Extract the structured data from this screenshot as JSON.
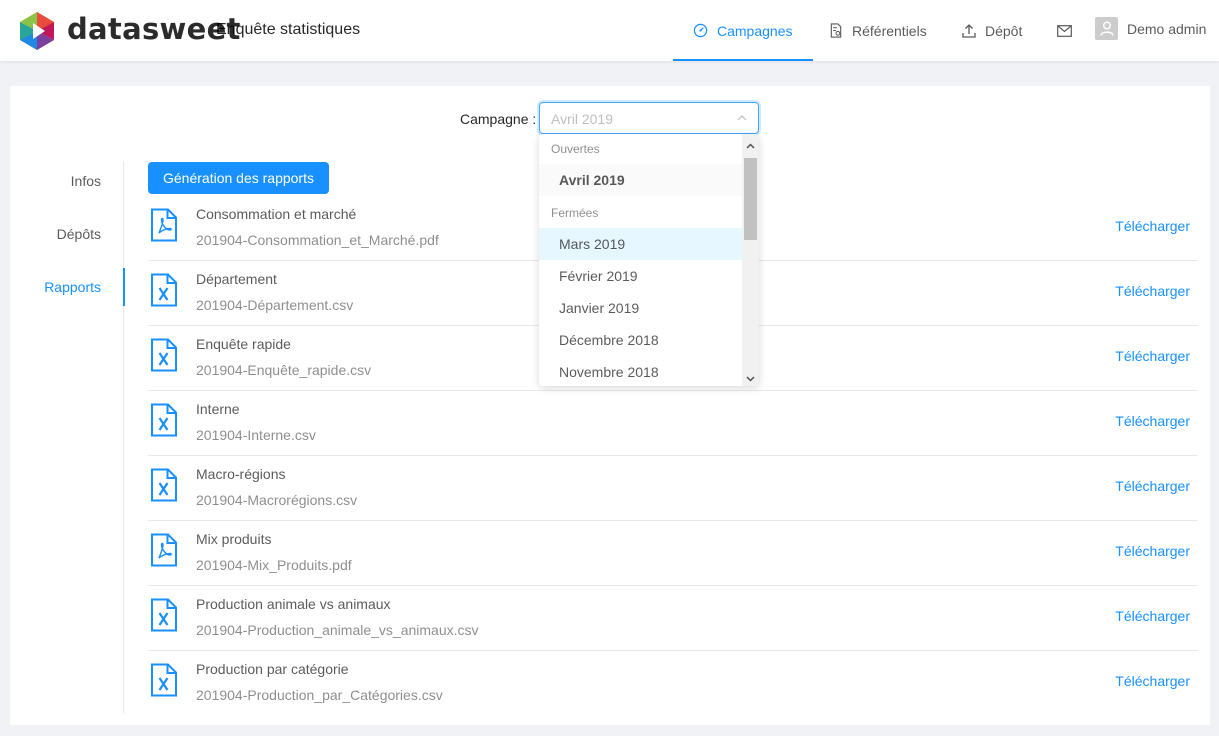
{
  "header": {
    "brand": "datasweet",
    "app_title": "Enquête statistiques",
    "nav": {
      "campagnes": "Campagnes",
      "referentiels": "Référentiels",
      "depot": "Dépôt"
    },
    "user": "Demo admin"
  },
  "campaign": {
    "label": "Campagne :",
    "value": "Avril 2019"
  },
  "tabs": [
    "Infos",
    "Dépôts",
    "Rapports"
  ],
  "generate_button": "Génération des rapports",
  "reports": [
    {
      "title": "Consommation et marché",
      "file": "201904-Consommation_et_Marché.pdf",
      "type": "pdf"
    },
    {
      "title": "Département",
      "file": "201904-Département.csv",
      "type": "csv"
    },
    {
      "title": "Enquête rapide",
      "file": "201904-Enquête_rapide.csv",
      "type": "csv"
    },
    {
      "title": "Interne",
      "file": "201904-Interne.csv",
      "type": "csv"
    },
    {
      "title": "Macro-régions",
      "file": "201904-Macrorégions.csv",
      "type": "csv"
    },
    {
      "title": "Mix produits",
      "file": "201904-Mix_Produits.pdf",
      "type": "pdf"
    },
    {
      "title": "Production animale vs animaux",
      "file": "201904-Production_animale_vs_animaux.csv",
      "type": "csv"
    },
    {
      "title": "Production par catégorie",
      "file": "201904-Production_par_Catégories.csv",
      "type": "csv"
    }
  ],
  "download_label": "Télécharger",
  "dropdown": {
    "group_open": "Ouvertes",
    "open_options": [
      "Avril 2019"
    ],
    "group_closed": "Fermées",
    "closed_options": [
      "Mars 2019",
      "Février 2019",
      "Janvier 2019",
      "Décembre 2018",
      "Novembre 2018"
    ]
  },
  "colors": {
    "primary": "#1890ff",
    "border": "#e8e8e8",
    "background": "#f0f2f5"
  }
}
